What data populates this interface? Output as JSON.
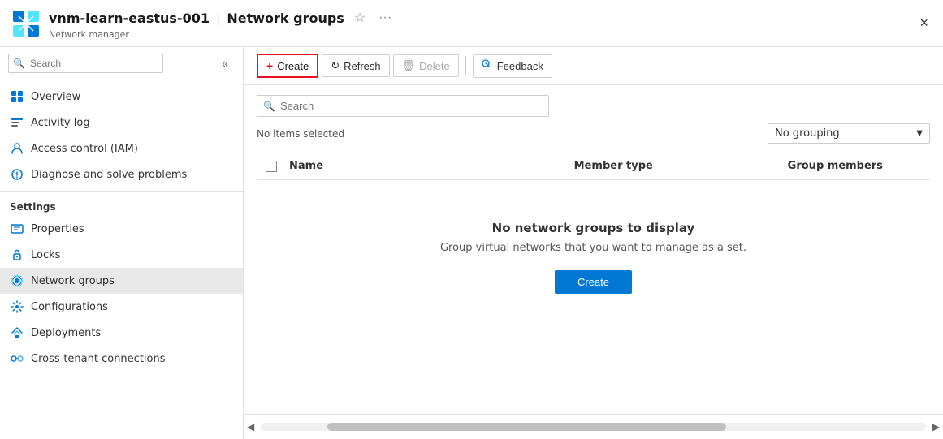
{
  "titleBar": {
    "resourceName": "vnm-learn-eastus-001",
    "separator": "|",
    "resourceType": "Network groups",
    "subTitle": "Network manager",
    "closeLabel": "×"
  },
  "sidebar": {
    "searchPlaceholder": "Search",
    "collapseIcon": "«",
    "navItems": [
      {
        "id": "overview",
        "label": "Overview",
        "iconType": "overview"
      },
      {
        "id": "activity-log",
        "label": "Activity log",
        "iconType": "log"
      },
      {
        "id": "access-control",
        "label": "Access control (IAM)",
        "iconType": "iam"
      },
      {
        "id": "diagnose",
        "label": "Diagnose and solve problems",
        "iconType": "diagnose"
      }
    ],
    "settingsLabel": "Settings",
    "settingsItems": [
      {
        "id": "properties",
        "label": "Properties",
        "iconType": "properties"
      },
      {
        "id": "locks",
        "label": "Locks",
        "iconType": "locks"
      },
      {
        "id": "network-groups",
        "label": "Network groups",
        "iconType": "network",
        "active": true
      },
      {
        "id": "configurations",
        "label": "Configurations",
        "iconType": "config"
      },
      {
        "id": "deployments",
        "label": "Deployments",
        "iconType": "deploy"
      },
      {
        "id": "cross-tenant",
        "label": "Cross-tenant connections",
        "iconType": "cross"
      }
    ]
  },
  "toolbar": {
    "createLabel": "Create",
    "refreshLabel": "Refresh",
    "deleteLabel": "Delete",
    "feedbackLabel": "Feedback"
  },
  "content": {
    "searchPlaceholder": "Search",
    "noItemsText": "No items selected",
    "groupingLabel": "No grouping",
    "table": {
      "colName": "Name",
      "colMemberType": "Member type",
      "colGroupMembers": "Group members"
    },
    "emptyState": {
      "title": "No network groups to display",
      "subtitle": "Group virtual networks that you want to manage as a set.",
      "createLabel": "Create"
    }
  }
}
